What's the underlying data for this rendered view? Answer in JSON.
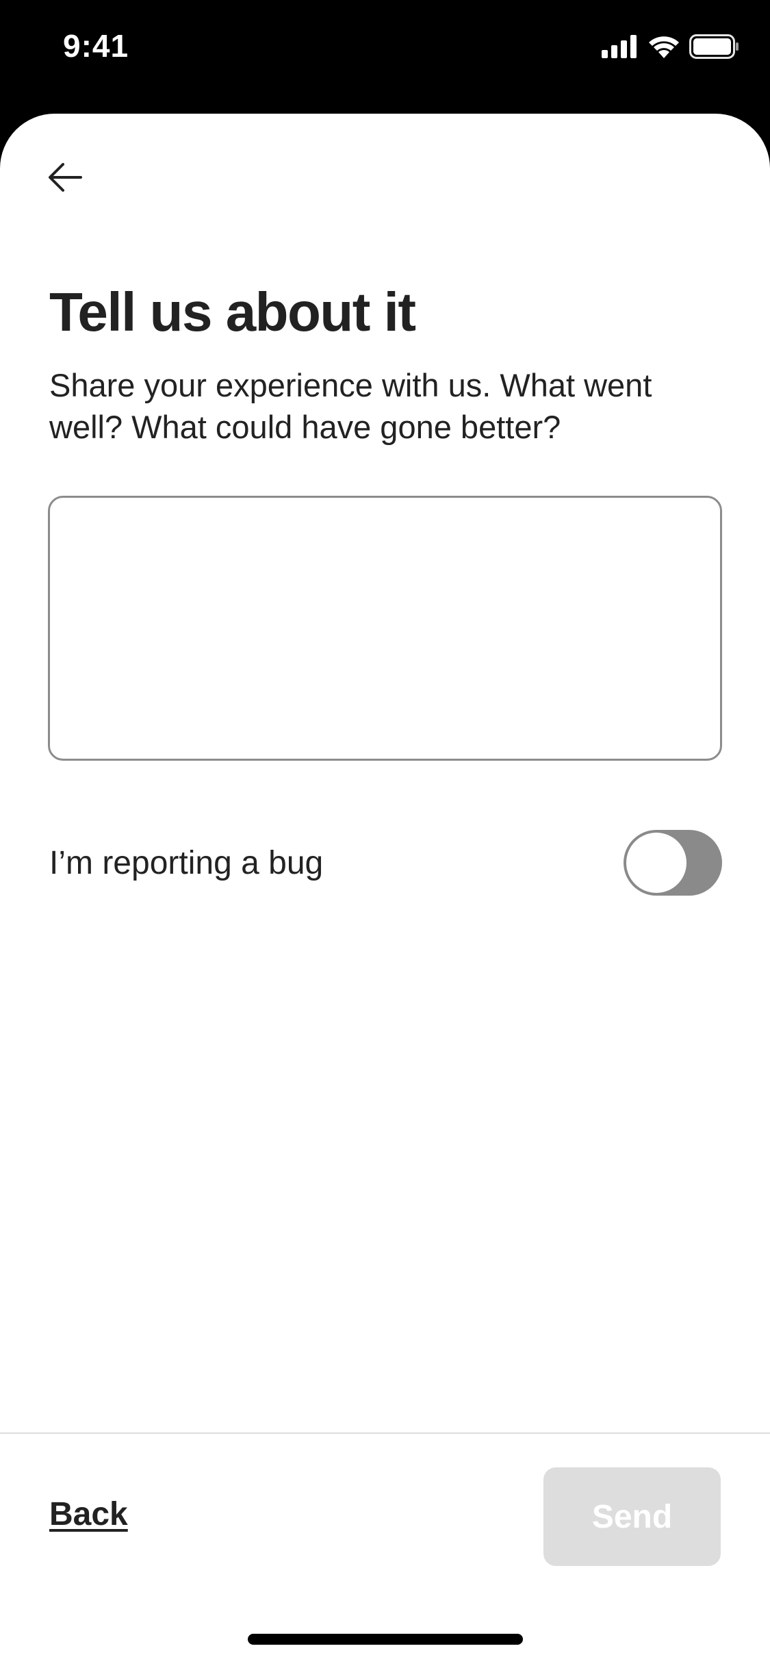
{
  "status_bar": {
    "time": "9:41",
    "icons": [
      "signal-icon",
      "wifi-icon",
      "battery-icon"
    ]
  },
  "header": {
    "back_icon": "arrow-left-icon"
  },
  "main": {
    "title": "Tell us about it",
    "subtitle": "Share your experience with us. What went well? What could have gone better?",
    "feedback_value": "",
    "bug_toggle": {
      "label": "I’m reporting a bug",
      "on": false
    }
  },
  "footer": {
    "back_label": "Back",
    "send_label": "Send",
    "send_enabled": false
  },
  "colors": {
    "text": "#222222",
    "toggle_off": "#8a8a8a",
    "button_disabled": "#dddddd",
    "input_border": "#8c8c8c"
  }
}
